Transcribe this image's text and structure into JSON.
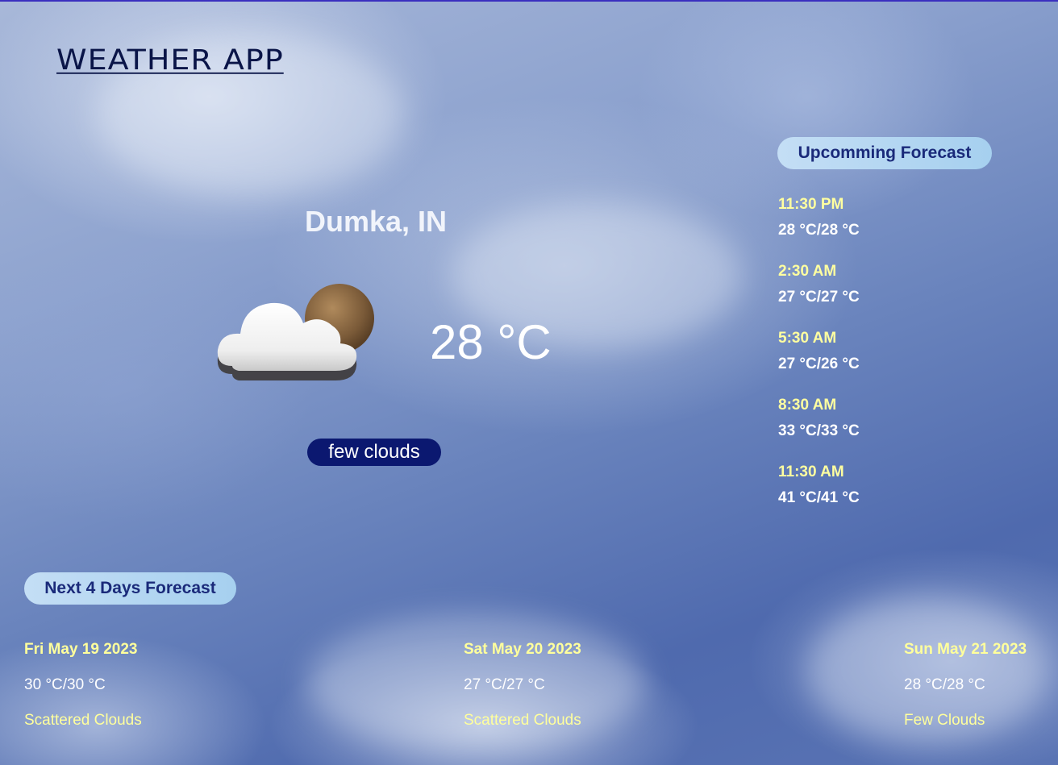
{
  "app": {
    "title": "WEATHER APP"
  },
  "current": {
    "city": "Dumka, IN",
    "temperature": "28 °C",
    "description": "few clouds",
    "icon": "few-clouds-icon"
  },
  "upcoming": {
    "label": "Upcomming Forecast",
    "items": [
      {
        "time": "11:30 PM",
        "temp": "28 °C/28 °C"
      },
      {
        "time": "2:30 AM",
        "temp": "27 °C/27 °C"
      },
      {
        "time": "5:30 AM",
        "temp": "27 °C/26 °C"
      },
      {
        "time": "8:30 AM",
        "temp": "33 °C/33 °C"
      },
      {
        "time": "11:30 AM",
        "temp": "41 °C/41 °C"
      }
    ]
  },
  "days": {
    "label": "Next 4 Days Forecast",
    "items": [
      {
        "date": "Fri May 19 2023",
        "temp": "30 °C/30 °C",
        "desc": "Scattered Clouds"
      },
      {
        "date": "Sat May 20 2023",
        "temp": "27 °C/27 °C",
        "desc": "Scattered Clouds"
      },
      {
        "date": "Sun May 21 2023",
        "temp": "28 °C/28 °C",
        "desc": "Few Clouds"
      }
    ]
  },
  "colors": {
    "title": "#0a1548",
    "pill_dark": "#0b1870",
    "pill_light": "#a6d0ef",
    "accent_yellow": "#ffffa0"
  }
}
